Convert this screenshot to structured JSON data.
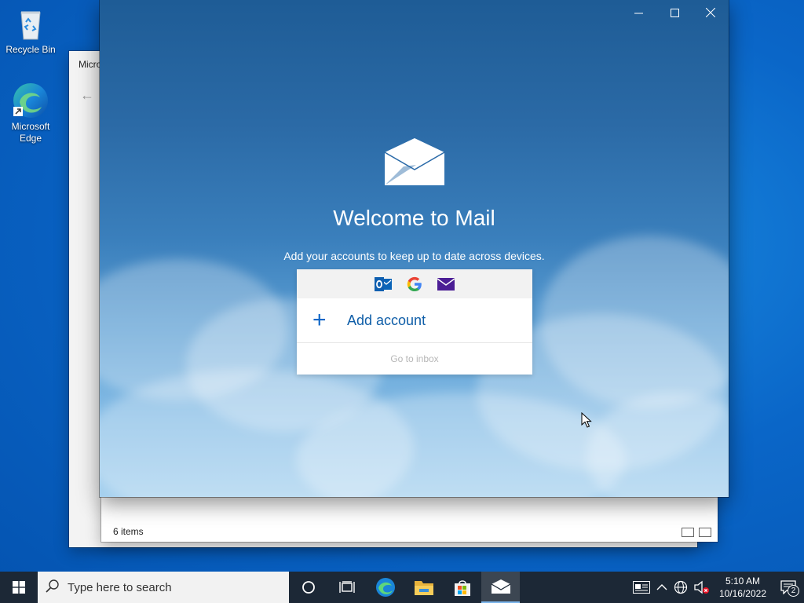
{
  "desktop": {
    "icons": [
      {
        "label": "Recycle Bin",
        "icon": "recycle-bin-icon"
      },
      {
        "label": "Microsoft Edge",
        "icon": "edge-icon"
      }
    ]
  },
  "background_window": {
    "title": "Micro",
    "status_text": "6 items"
  },
  "mail": {
    "title": "Welcome to Mail",
    "subtitle": "Add your accounts to keep up to date across devices.",
    "providers": [
      "outlook-icon",
      "google-icon",
      "mail-icon"
    ],
    "add_account_label": "Add account",
    "go_to_inbox_label": "Go to inbox"
  },
  "taskbar": {
    "search_placeholder": "Type here to search",
    "apps": [
      "cortana-icon",
      "task-view-icon",
      "edge-icon",
      "file-explorer-icon",
      "store-icon",
      "mail-icon"
    ],
    "clock_time": "5:10 AM",
    "clock_date": "10/16/2022",
    "notification_count": "2"
  },
  "colors": {
    "accent": "#0f67c7",
    "taskbar": "#1c2836",
    "desktop": "#0a66c8"
  }
}
